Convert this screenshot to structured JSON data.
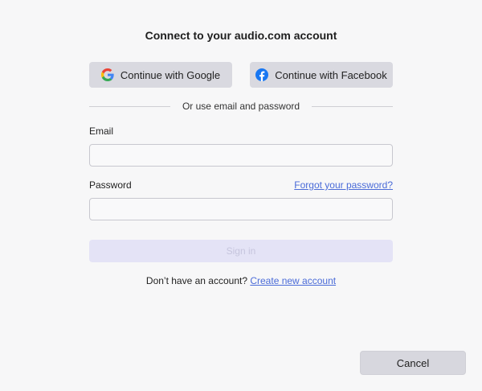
{
  "dialog": {
    "title": "Connect to your audio.com account"
  },
  "social": {
    "google_label": "Continue with Google",
    "google_icon": "google-icon",
    "facebook_label": "Continue with Facebook",
    "facebook_icon": "facebook-icon",
    "facebook_color": "#1877f2"
  },
  "divider": {
    "text": "Or use email and password"
  },
  "form": {
    "email_label": "Email",
    "email_value": "",
    "password_label": "Password",
    "password_value": "",
    "forgot_link": "Forgot your password?",
    "signin_label": "Sign in",
    "signin_enabled": false
  },
  "footer": {
    "no_account_text": "Don’t have an account?",
    "create_link": "Create new account",
    "cancel_label": "Cancel"
  },
  "colors": {
    "accent_link": "#4a6bd8",
    "signin_disabled_bg": "#e4e3f6"
  }
}
